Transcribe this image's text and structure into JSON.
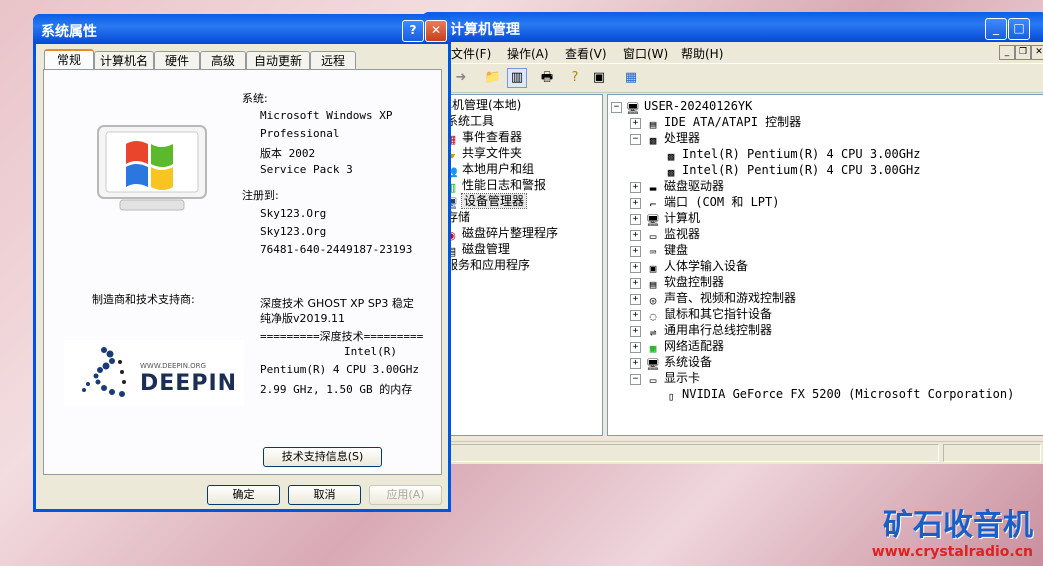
{
  "cm": {
    "title": "计算机管理",
    "menu": [
      "文件(F)",
      "操作(A)",
      "查看(V)",
      "窗口(W)",
      "帮助(H)"
    ],
    "left_tree": [
      {
        "label": "计算机管理(本地)",
        "icon": "computer-icon"
      },
      {
        "label": "系统工具",
        "icon": "tools-icon"
      },
      {
        "label": "事件查看器",
        "icon": "event-icon"
      },
      {
        "label": "共享文件夹",
        "icon": "folder-icon"
      },
      {
        "label": "本地用户和组",
        "icon": "users-icon"
      },
      {
        "label": "性能日志和警报",
        "icon": "perf-icon"
      },
      {
        "label": "设备管理器",
        "icon": "device-icon"
      },
      {
        "label": "存储",
        "icon": "storage-icon"
      },
      {
        "label": "磁盘碎片整理程序",
        "icon": "defrag-icon"
      },
      {
        "label": "磁盘管理",
        "icon": "disk-icon"
      },
      {
        "label": "服务和应用程序",
        "icon": "services-icon"
      }
    ],
    "right_tree": [
      {
        "label": "USER-20240126YK"
      },
      {
        "label": "IDE ATA/ATAPI 控制器"
      },
      {
        "label": "处理器"
      },
      {
        "label": "Intel(R) Pentium(R) 4 CPU 3.00GHz"
      },
      {
        "label": "Intel(R) Pentium(R) 4 CPU 3.00GHz"
      },
      {
        "label": "磁盘驱动器"
      },
      {
        "label": "端口 (COM 和 LPT)"
      },
      {
        "label": "计算机"
      },
      {
        "label": "监视器"
      },
      {
        "label": "键盘"
      },
      {
        "label": "人体学输入设备"
      },
      {
        "label": "软盘控制器"
      },
      {
        "label": "声音、视频和游戏控制器"
      },
      {
        "label": "鼠标和其它指针设备"
      },
      {
        "label": "通用串行总线控制器"
      },
      {
        "label": "网络适配器"
      },
      {
        "label": "系统设备"
      },
      {
        "label": "显示卡"
      },
      {
        "label": "NVIDIA GeForce FX 5200  (Microsoft Corporation)"
      }
    ]
  },
  "sp": {
    "title": "系统属性",
    "help_glyph": "?",
    "close_glyph": "✕",
    "tabs": [
      "常规",
      "计算机名",
      "硬件",
      "高级",
      "自动更新",
      "远程"
    ],
    "system_label": "系统:",
    "system_lines": [
      "Microsoft Windows XP",
      "Professional",
      "版本 2002",
      "Service Pack 3"
    ],
    "registered_label": "注册到:",
    "registered_lines": [
      "Sky123.Org",
      "Sky123.Org",
      "76481-640-2449187-23193"
    ],
    "manufacturer_label": "制造商和技术支持商:",
    "oem_lines": [
      "深度技术 GHOST XP SP3 稳定",
      "纯净版v2019.11",
      "=========深度技术=========",
      "Intel(R)",
      "Pentium(R) 4 CPU 3.00GHz",
      "2.99 GHz, 1.50 GB 的内存"
    ],
    "logo_url": "WWW.DEEPIN.ORG",
    "logo_text": "DEEPIN",
    "support_button": "技术支持信息(S)",
    "ok": "确定",
    "cancel": "取消",
    "apply": "应用(A)"
  },
  "watermark": {
    "title": "矿石收音机",
    "url": "www.crystalradio.cn"
  },
  "colors": {
    "xp_blue": "#0054e3",
    "dialog_bg": "#ece9d8",
    "tab_accent": "#e68b2c"
  }
}
